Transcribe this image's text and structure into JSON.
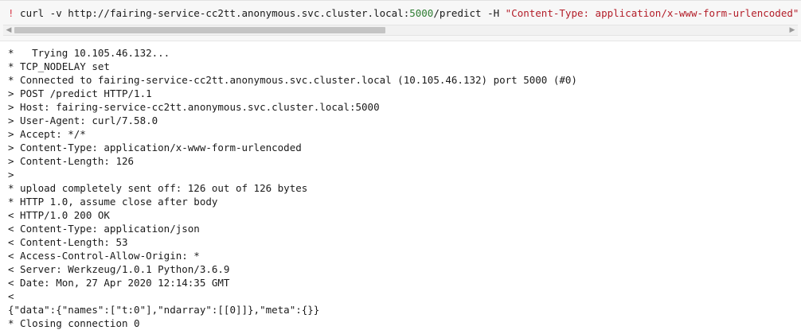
{
  "code_cell": {
    "bang": "!",
    "cmd_part1": " curl -v http://fairing-service-cc2tt.anonymous.svc.cluster.local:",
    "port": "5000",
    "cmd_part2": "/predict -H ",
    "header_string": "\"Content-Type: application/x-www-form-urlencoded\""
  },
  "scrollbar": {
    "left_arrow": "◀",
    "right_arrow": "▶",
    "position_fraction": 0.0,
    "visible_fraction": 0.48
  },
  "output_lines": [
    "*   Trying 10.105.46.132...",
    "* TCP_NODELAY set",
    "* Connected to fairing-service-cc2tt.anonymous.svc.cluster.local (10.105.46.132) port 5000 (#0)",
    "> POST /predict HTTP/1.1",
    "> Host: fairing-service-cc2tt.anonymous.svc.cluster.local:5000",
    "> User-Agent: curl/7.58.0",
    "> Accept: */*",
    "> Content-Type: application/x-www-form-urlencoded",
    "> Content-Length: 126",
    ">",
    "* upload completely sent off: 126 out of 126 bytes",
    "* HTTP 1.0, assume close after body",
    "< HTTP/1.0 200 OK",
    "< Content-Type: application/json",
    "< Content-Length: 53",
    "< Access-Control-Allow-Origin: *",
    "< Server: Werkzeug/1.0.1 Python/3.6.9",
    "< Date: Mon, 27 Apr 2020 12:14:35 GMT",
    "<",
    "{\"data\":{\"names\":[\"t:0\"],\"ndarray\":[[0]]},\"meta\":{}}",
    "* Closing connection 0"
  ]
}
